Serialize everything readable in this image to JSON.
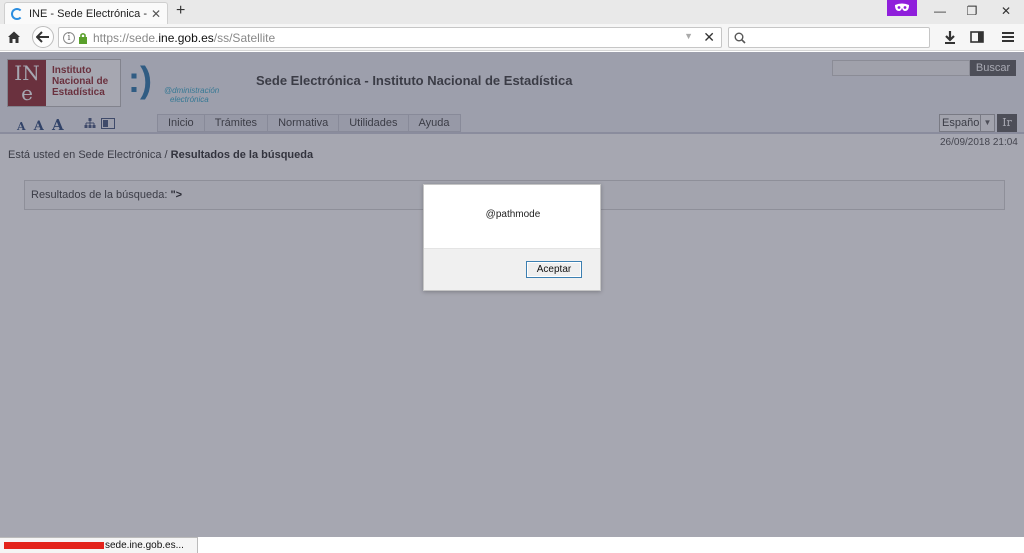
{
  "browser": {
    "tab_title": "INE - Sede Electrónica - Re...",
    "url_prefix": "https://sede.",
    "url_domain": "ine.gob.es",
    "url_path": "/ss/Satellite",
    "status_text": "sede.ine.gob.es..."
  },
  "header": {
    "logo_mark_top": "IN",
    "logo_mark_bottom": "e",
    "logo_line1": "Instituto",
    "logo_line2": "Nacional de",
    "logo_line3": "Estadística",
    "admin_smiley": ":)",
    "admin_line1": "@dministración",
    "admin_line2": "electrónica",
    "site_title": "Sede Electrónica - Instituto Nacional de Estadística",
    "search_button": "Buscar",
    "font_small": "A",
    "font_medium": "A",
    "font_large": "A",
    "menu": [
      "Inicio",
      "Trámites",
      "Normativa",
      "Utilidades",
      "Ayuda"
    ],
    "language": "Español",
    "language_go": "Ir"
  },
  "main": {
    "timestamp": "26/09/2018 21:04",
    "breadcrumb_prefix": "Está usted en Sede Electrónica /",
    "breadcrumb_current": "Resultados de la búsqueda",
    "results_label": "Resultados de la búsqueda:",
    "results_query": "\">"
  },
  "dialog": {
    "message": "@pathmode",
    "accept_button": "Aceptar"
  },
  "colors": {
    "ine_red": "#8c1d24",
    "private_purple": "#8f1fdb",
    "overlay": "#46485c"
  }
}
